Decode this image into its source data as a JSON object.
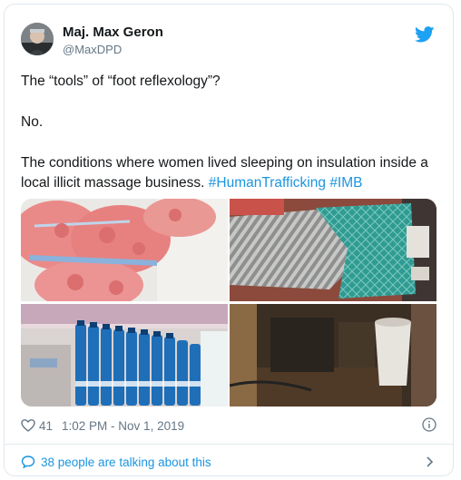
{
  "tweet": {
    "author_name": "Maj. Max Geron",
    "author_handle": "@MaxDPD",
    "paragraphs": [
      {
        "text": "The “tools” of “foot reflexology”?"
      },
      {
        "text": "No."
      },
      {
        "text": "The conditions where women lived sleeping on insulation inside a local illicit massage business. "
      }
    ],
    "hashtags": [
      "#HumanTrafficking",
      "#IMB"
    ],
    "like_count": "41",
    "timestamp": "1:02 PM - Nov 1, 2019",
    "conversation_label": "38 people are talking about this"
  },
  "icons": {
    "brand": "twitter-bird-icon",
    "like": "heart-icon",
    "info": "info-icon",
    "conversation": "speech-bubble-icon",
    "chevron": "chevron-right-icon"
  },
  "colors": {
    "link": "#1b95e0",
    "secondary_text": "#657786",
    "border": "#e1e8ed",
    "brand": "#1da1f2"
  }
}
